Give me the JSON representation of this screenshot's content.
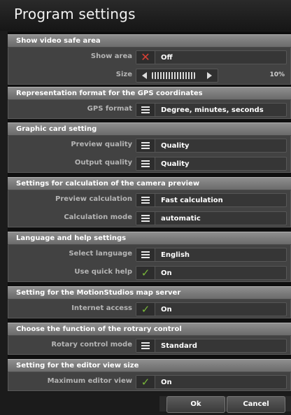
{
  "window": {
    "title": "Program settings"
  },
  "sections": [
    {
      "header": "Show video safe area",
      "rows": [
        {
          "label": "Show area",
          "icon": "x-icon",
          "value": "Off"
        },
        {
          "label": "Size",
          "slider_percent": "10%",
          "slider_fraction": 0.1
        }
      ]
    },
    {
      "header": "Representation format for the GPS coordinates",
      "rows": [
        {
          "label": "GPS format",
          "icon": "menu-icon",
          "value": "Degree, minutes, seconds"
        }
      ]
    },
    {
      "header": "Graphic card setting",
      "rows": [
        {
          "label": "Preview quality",
          "icon": "menu-icon",
          "value": "Quality"
        },
        {
          "label": "Output quality",
          "icon": "menu-icon",
          "value": "Quality"
        }
      ]
    },
    {
      "header": "Settings for calculation of the camera preview",
      "rows": [
        {
          "label": "Preview calculation",
          "icon": "menu-icon",
          "value": "Fast calculation"
        },
        {
          "label": "Calculation mode",
          "icon": "menu-icon",
          "value": "automatic"
        }
      ]
    },
    {
      "header": "Language and help settings",
      "rows": [
        {
          "label": "Select language",
          "icon": "menu-icon",
          "value": "English"
        },
        {
          "label": "Use quick help",
          "icon": "check-icon",
          "value": "On"
        }
      ]
    },
    {
      "header": "Setting for the MotionStudios map server",
      "rows": [
        {
          "label": "Internet access",
          "icon": "check-icon",
          "value": "On"
        }
      ]
    },
    {
      "header": "Choose the function of the rotrary control",
      "rows": [
        {
          "label": "Rotary control mode",
          "icon": "menu-icon",
          "value": "Standard"
        }
      ]
    },
    {
      "header": "Setting for the editor view size",
      "rows": [
        {
          "label": "Maximum editor view",
          "icon": "check-icon",
          "value": "On"
        }
      ]
    }
  ],
  "buttons": {
    "ok": "Ok",
    "cancel": "Cancel"
  },
  "colors": {
    "accent_check": "#79b83a",
    "accent_x": "#d94035",
    "header_bg": "#7d7d7d"
  }
}
